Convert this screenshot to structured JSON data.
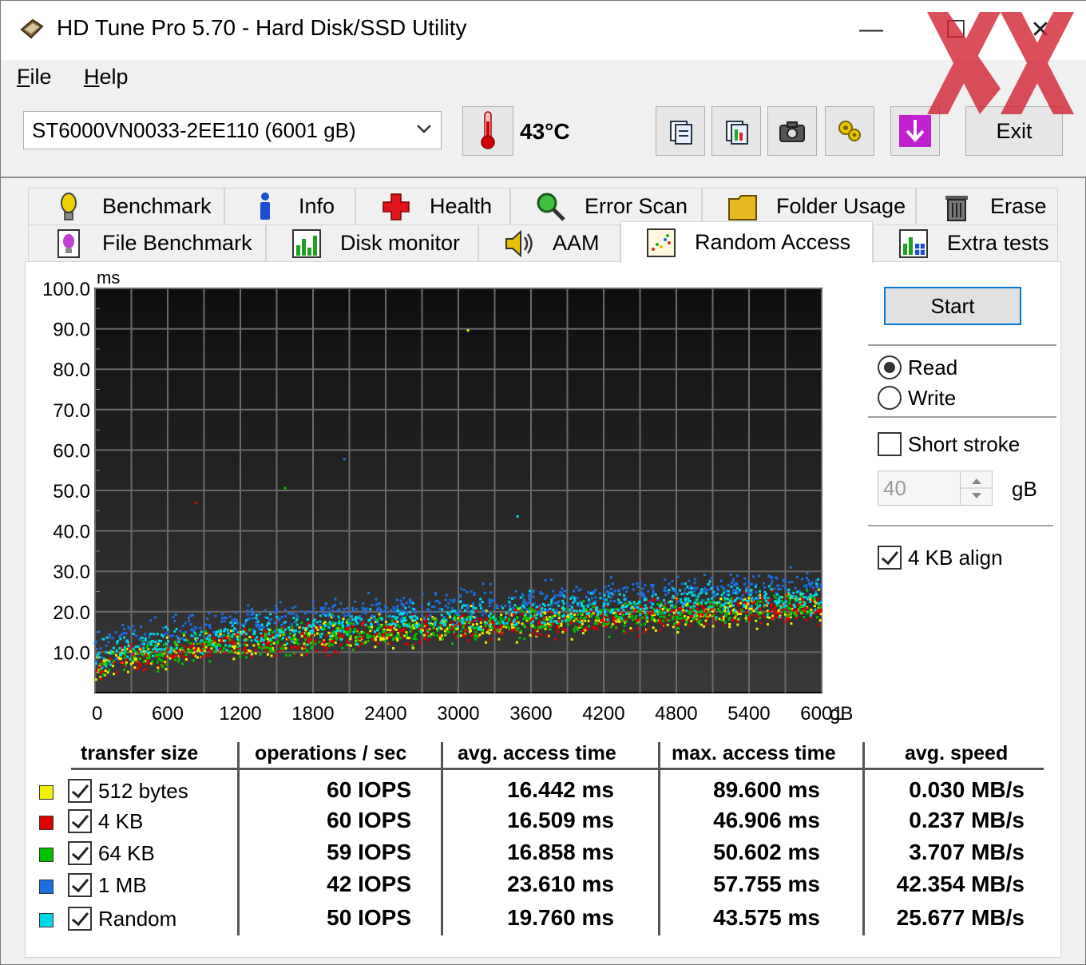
{
  "window": {
    "title": "HD Tune Pro 5.70 - Hard Disk/SSD Utility",
    "minimize": "—",
    "maximize": "☐",
    "close": "✕"
  },
  "menu": {
    "file": "File",
    "help": "Help"
  },
  "toolbar": {
    "drive": "ST6000VN0033-2EE110 (6001 gB)",
    "temperature": "43°C",
    "exit_label": "Exit",
    "buttons": [
      "copy-text-icon",
      "copy-screenshot-icon",
      "camera-icon",
      "options-icon",
      "save-download-icon"
    ]
  },
  "tabs": {
    "row1": [
      "Benchmark",
      "Info",
      "Health",
      "Error Scan",
      "Folder Usage",
      "Erase"
    ],
    "row2": [
      "File Benchmark",
      "Disk monitor",
      "AAM",
      "Random Access",
      "Extra tests"
    ],
    "active": "Random Access"
  },
  "controls": {
    "start_label": "Start",
    "read_label": "Read",
    "write_label": "Write",
    "mode_selected": "Read",
    "short_stroke_label": "Short stroke",
    "short_stroke_checked": false,
    "short_stroke_value": "40",
    "short_stroke_unit": "gB",
    "align_label": "4 KB align",
    "align_checked": true
  },
  "chart_data": {
    "type": "scatter",
    "y_unit_label": "ms",
    "x_unit_label": "gB",
    "ylim": [
      0,
      100
    ],
    "xlim": [
      0,
      6001
    ],
    "y_ticks": [
      "100.0",
      "90.0",
      "80.0",
      "70.0",
      "60.0",
      "50.0",
      "40.0",
      "30.0",
      "20.0",
      "10.0"
    ],
    "x_ticks": [
      "0",
      "600",
      "1200",
      "1800",
      "2400",
      "3000",
      "3600",
      "4200",
      "4800",
      "5400",
      "6001"
    ],
    "grid": true,
    "background": "#1a1a1a",
    "series": [
      {
        "name": "512 bytes",
        "color": "#f0f000",
        "avg_ms": 16.442,
        "max_ms": 89.6,
        "max_at_gb": 3080
      },
      {
        "name": "4 KB",
        "color": "#e00000",
        "avg_ms": 16.509,
        "max_ms": 46.906,
        "max_at_gb": 830
      },
      {
        "name": "64 KB",
        "color": "#00c000",
        "avg_ms": 16.858,
        "max_ms": 50.602,
        "max_at_gb": 1570
      },
      {
        "name": "1 MB",
        "color": "#1a6fe0",
        "avg_ms": 23.61,
        "max_ms": 57.755,
        "max_at_gb": 2060
      },
      {
        "name": "Random",
        "color": "#00d8e8",
        "avg_ms": 19.76,
        "max_ms": 43.575,
        "max_at_gb": 3490
      }
    ]
  },
  "table": {
    "headers": [
      "transfer size",
      "operations / sec",
      "avg. access time",
      "max. access time",
      "avg. speed"
    ],
    "rows": [
      {
        "label": "512 bytes",
        "color": "#f0f000",
        "iops": "60 IOPS",
        "avg": "16.442 ms",
        "max": "89.600 ms",
        "speed": "0.030 MB/s"
      },
      {
        "label": "4 KB",
        "color": "#e00000",
        "iops": "60 IOPS",
        "avg": "16.509 ms",
        "max": "46.906 ms",
        "speed": "0.237 MB/s"
      },
      {
        "label": "64 KB",
        "color": "#00c000",
        "iops": "59 IOPS",
        "avg": "16.858 ms",
        "max": "50.602 ms",
        "speed": "3.707 MB/s"
      },
      {
        "label": "1 MB",
        "color": "#1a6fe0",
        "iops": "42 IOPS",
        "avg": "23.610 ms",
        "max": "57.755 ms",
        "speed": "42.354 MB/s"
      },
      {
        "label": "Random",
        "color": "#00d8e8",
        "iops": "50 IOPS",
        "avg": "19.760 ms",
        "max": "43.575 ms",
        "speed": "25.677 MB/s"
      }
    ]
  }
}
